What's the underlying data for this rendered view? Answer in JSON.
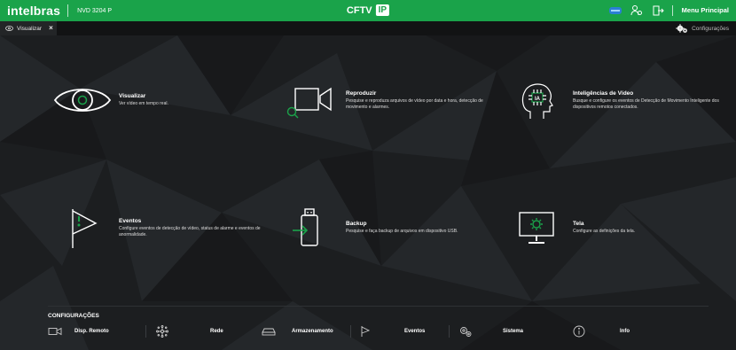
{
  "header": {
    "logo": "intelbras",
    "model": "NVD 3204 P",
    "product": "CFTV",
    "product_badge": "IP",
    "menu_label": "Menu Principal",
    "accent_color": "#1aa34a",
    "icons": [
      "storage-icon",
      "users-icon",
      "logout-icon"
    ]
  },
  "tabs": {
    "active": {
      "label": "Visualizar",
      "close": "×"
    },
    "config_label": "Configurações"
  },
  "tiles": [
    {
      "title": "Visualizar",
      "desc": "Ver vídeo em tempo real.",
      "icon": "eye-icon"
    },
    {
      "title": "Reproduzir",
      "desc": "Pesquise e reproduza arquivos de vídeo por data e hora, detecção de movimento e alarmes.",
      "icon": "playback-icon"
    },
    {
      "title": "Inteligências de Vídeo",
      "desc": "Busque e configure os eventos de Detecção de Movimento Inteligente dos dispositivos remotos conectados.",
      "icon": "ai-head-icon"
    },
    {
      "title": "Eventos",
      "desc": "Configure eventos de detecção de vídeo, status de alarme e eventos de anormalidade.",
      "icon": "flag-icon"
    },
    {
      "title": "Backup",
      "desc": "Pesquise e faça backup de arquivos em dispositivo USB.",
      "icon": "usb-backup-icon"
    },
    {
      "title": "Tela",
      "desc": "Configure as definições da tela.",
      "icon": "monitor-settings-icon"
    }
  ],
  "configuracoes": {
    "title": "CONFIGURAÇÕES",
    "items": [
      {
        "label": "Disp. Remoto",
        "icon": "camera-icon"
      },
      {
        "label": "Rede",
        "icon": "network-icon"
      },
      {
        "label": "Armazenamento",
        "icon": "hdd-icon"
      },
      {
        "label": "Eventos",
        "icon": "flag-icon"
      },
      {
        "label": "Sistema",
        "icon": "gears-icon"
      },
      {
        "label": "Info",
        "icon": "info-icon"
      }
    ]
  }
}
